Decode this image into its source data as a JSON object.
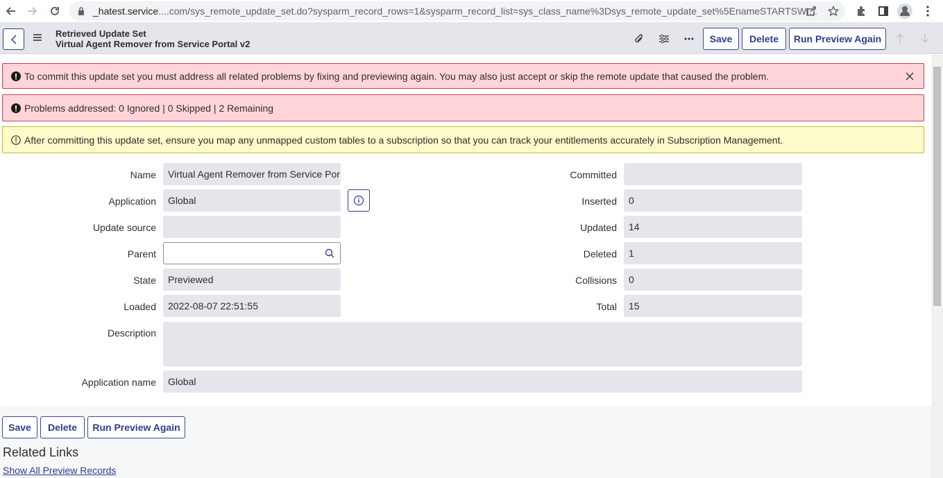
{
  "browser": {
    "url_host": "_hatest.service",
    "url_rest": "....com/sys_remote_update_set.do?sysparm_record_rows=1&sysparm_record_list=sys_class_name%3Dsys_remote_update_set%5EnameSTARTSWI..."
  },
  "header": {
    "title": "Retrieved Update Set",
    "subtitle": "Virtual Agent Remover from Service Portal v2",
    "save_label": "Save",
    "delete_label": "Delete",
    "run_preview_label": "Run Preview Again"
  },
  "alerts": {
    "commit_error": "To commit this update set you must address all related problems by fixing and previewing again. You may also just accept or skip the remote update that caused the problem.",
    "problems": "Problems addressed: 0 Ignored | 0 Skipped | 2 Remaining",
    "subscription_warning": "After committing this update set, ensure you map any unmapped custom tables to a subscription so that you can track your entitlements accurately in Subscription Management."
  },
  "form": {
    "left": [
      {
        "label": "Name",
        "value": "Virtual Agent Remover from Service Por"
      },
      {
        "label": "Application",
        "value": "Global"
      },
      {
        "label": "Update source",
        "value": ""
      },
      {
        "label": "Parent",
        "value": ""
      },
      {
        "label": "State",
        "value": "Previewed"
      },
      {
        "label": "Loaded",
        "value": "2022-08-07 22:51:55"
      }
    ],
    "right": [
      {
        "label": "Committed",
        "value": ""
      },
      {
        "label": "Inserted",
        "value": "0"
      },
      {
        "label": "Updated",
        "value": "14"
      },
      {
        "label": "Deleted",
        "value": "1"
      },
      {
        "label": "Collisions",
        "value": "0"
      },
      {
        "label": "Total",
        "value": "15"
      }
    ],
    "description_label": "Description",
    "description_value": "",
    "app_name_label": "Application name",
    "app_name_value": "Global"
  },
  "footer": {
    "save_label": "Save",
    "delete_label": "Delete",
    "run_preview_label": "Run Preview Again",
    "related_title": "Related Links",
    "related_link": "Show All Preview Records"
  },
  "colors": {
    "accent": "#2c3e8f",
    "error_bg": "#ffd5d9",
    "warning_bg": "#fdfbc9",
    "field_bg": "#e4e6eb"
  }
}
